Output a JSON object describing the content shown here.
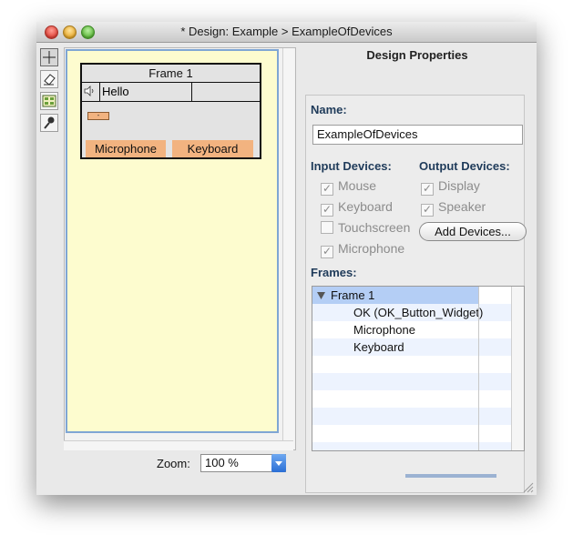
{
  "window": {
    "title": "* Design: Example > ExampleOfDevices"
  },
  "palette": {
    "tools": [
      "selection-icon",
      "eraser-icon",
      "widgets-icon",
      "microphone-icon"
    ]
  },
  "canvas": {
    "frame": {
      "title": "Frame 1",
      "label_text": "Hello",
      "ok_button_text": "-",
      "buttons": [
        "Microphone",
        "Keyboard"
      ]
    }
  },
  "zoom": {
    "label": "Zoom:",
    "value": "100 %"
  },
  "properties": {
    "title": "Design Properties",
    "name_label": "Name:",
    "name_value": "ExampleOfDevices",
    "input_devices_label": "Input Devices:",
    "output_devices_label": "Output Devices:",
    "input_devices": [
      {
        "label": "Mouse",
        "checked": true
      },
      {
        "label": "Keyboard",
        "checked": true
      },
      {
        "label": "Touchscreen",
        "checked": false
      },
      {
        "label": "Microphone",
        "checked": true
      }
    ],
    "output_devices": [
      {
        "label": "Display",
        "checked": true
      },
      {
        "label": "Speaker",
        "checked": true
      }
    ],
    "add_devices_label": "Add Devices...",
    "frames_label": "Frames:",
    "frames_tree": [
      {
        "label": "Frame 1",
        "level": 0,
        "expanded": true
      },
      {
        "label": "OK (OK_Button_Widget)",
        "level": 1
      },
      {
        "label": "Microphone",
        "level": 1
      },
      {
        "label": "Keyboard",
        "level": 1
      }
    ]
  },
  "colors": {
    "canvas_bg": "#fdfccf",
    "widget_fill": "#f2b380",
    "selection": "#b4cef5",
    "label_text": "#1f3b5a"
  }
}
